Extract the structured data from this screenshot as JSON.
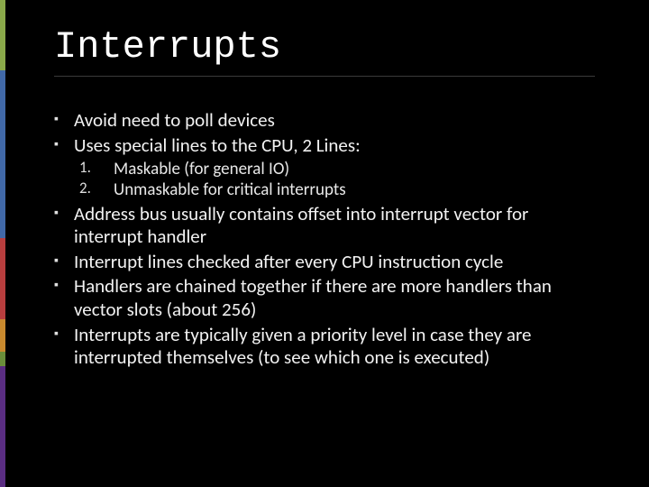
{
  "title": "Interrupts",
  "bullets": {
    "b0": "Avoid need to poll devices",
    "b1": "Uses special lines to the CPU, 2 Lines:",
    "b2": "Address bus usually contains offset into interrupt vector for interrupt handler",
    "b3": "Interrupt lines checked after every CPU instruction cycle",
    "b4": "Handlers are chained together if there are more handlers than vector slots (about 256)",
    "b5": "Interrupts are typically given a priority level in case they are interrupted themselves (to see which one is executed)"
  },
  "sub": {
    "n1": "1.",
    "s1": "Maskable (for general IO)",
    "n2": "2.",
    "s2": "Unmaskable for critical interrupts"
  }
}
